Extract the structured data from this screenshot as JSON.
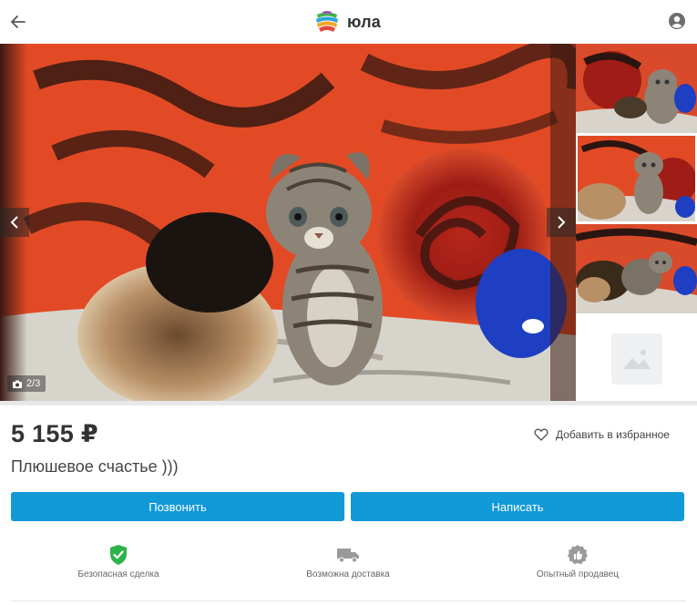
{
  "header": {
    "logo_text": "юла",
    "back_icon": "arrow-left-icon",
    "profile_icon": "user-circle-icon"
  },
  "gallery": {
    "counter": "2/3",
    "counter_icon": "camera-icon",
    "prev_icon": "chevron-left-icon",
    "next_icon": "chevron-right-icon",
    "thumbnail_count": 4,
    "empty_thumb_icon": "image-placeholder-icon"
  },
  "listing": {
    "price": "5 155 ₽",
    "title": "Плюшевое счастье )))",
    "favorite_label": "Добавить в избранное",
    "favorite_icon": "heart-icon"
  },
  "actions": {
    "call_label": "Позвонить",
    "write_label": "Написать"
  },
  "features": [
    {
      "label": "Безопасная сделка",
      "icon": "shield-check-icon"
    },
    {
      "label": "Возможна доставка",
      "icon": "truck-icon"
    },
    {
      "label": "Опытный продавец",
      "icon": "thumbs-up-badge-icon"
    }
  ],
  "colors": {
    "accent": "#1199d8",
    "safe_green": "#2cb34a",
    "muted_icon": "#9a9a9a"
  }
}
